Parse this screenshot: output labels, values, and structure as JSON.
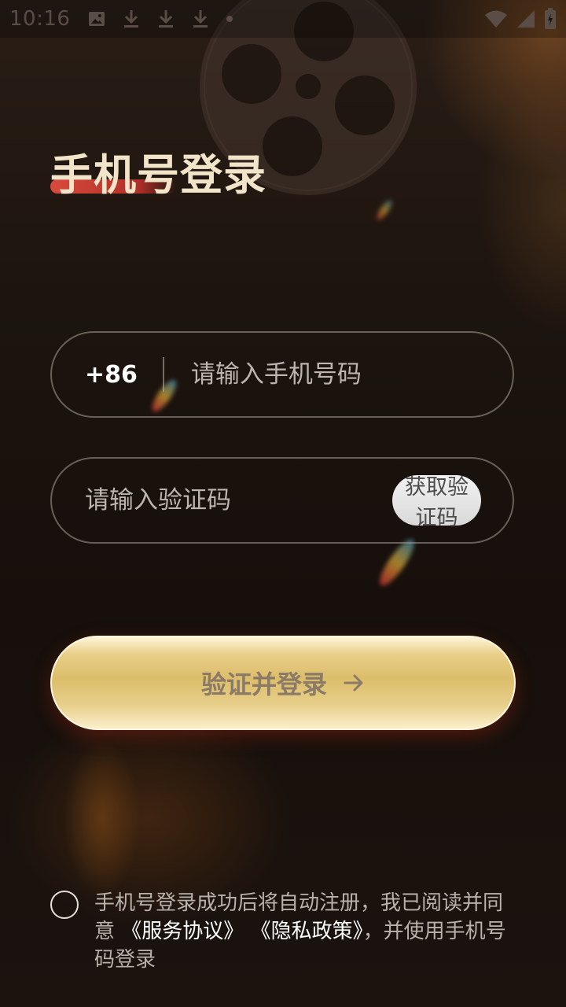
{
  "status_bar": {
    "time": "10:16",
    "left_icons": [
      "image-icon",
      "download-icon",
      "download-icon",
      "download-icon",
      "dot-icon"
    ],
    "right_icons": [
      "wifi-icon",
      "signal-icon",
      "battery-charging-icon"
    ]
  },
  "page": {
    "title": "手机号登录"
  },
  "phone": {
    "country_code": "+86",
    "placeholder": "请输入手机号码",
    "value": ""
  },
  "code": {
    "placeholder": "请输入验证码",
    "value": "",
    "get_code_label": "获取验证码"
  },
  "login": {
    "label": "验证并登录",
    "icon": "arrow-right-icon"
  },
  "agreement": {
    "checked": false,
    "text_prefix": "手机号登录成功后将自动注册，我已阅读并同意",
    "service_link": "《服务协议》",
    "privacy_link": "《隐私政策》",
    "text_suffix": "，并使用手机号码登录"
  },
  "colors": {
    "background": "#1a110c",
    "title": "#f2e4c8",
    "title_accent": "#d94a3c",
    "button_gold": "#dcbd6a",
    "button_text": "#8a7a66"
  }
}
